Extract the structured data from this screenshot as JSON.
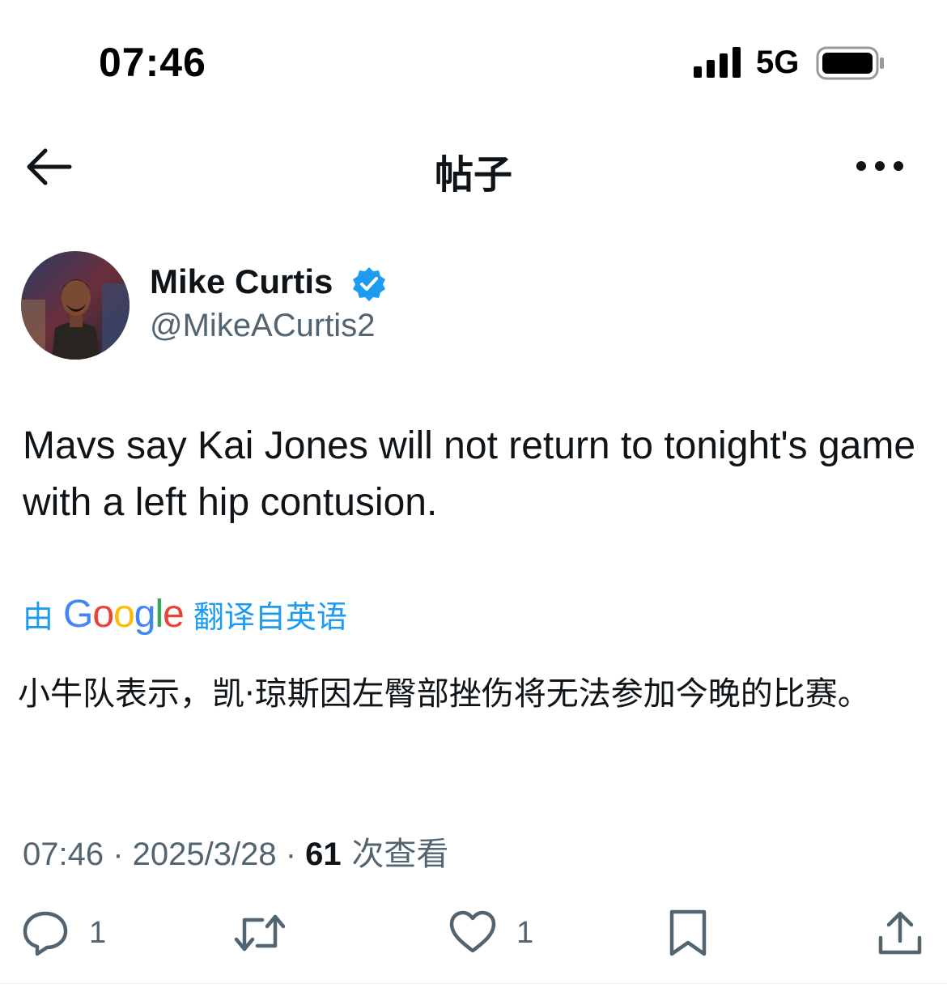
{
  "status_bar": {
    "time": "07:46",
    "network": "5G"
  },
  "header": {
    "title": "帖子"
  },
  "author": {
    "name": "Mike Curtis",
    "handle": "@MikeACurtis2",
    "verified": true
  },
  "tweet": {
    "text": "Mavs say Kai Jones will not return to tonight's game with a left hip contusion."
  },
  "translation": {
    "prefix": "由",
    "provider": "Google",
    "suffix": "翻译自英语",
    "text": "小牛队表示，凯·琼斯因左臀部挫伤将无法参加今晚的比赛。"
  },
  "meta": {
    "time": "07:46",
    "separator1": " · ",
    "date": "2025/3/28",
    "separator2": " · ",
    "views": "61",
    "views_label": " 次查看"
  },
  "actions": {
    "reply_count": "1",
    "like_count": "1"
  },
  "colors": {
    "accent": "#1d9bf0",
    "text": "#0f1419",
    "muted": "#536471",
    "google_blue": "#4285F4",
    "google_red": "#EA4335",
    "google_yellow": "#FBBC05",
    "google_green": "#34A853"
  },
  "icons": {
    "back": "arrow-left-icon",
    "more": "more-horizontal-icon",
    "reply": "reply-icon",
    "retweet": "retweet-icon",
    "like": "heart-icon",
    "bookmark": "bookmark-icon",
    "share": "share-icon"
  }
}
